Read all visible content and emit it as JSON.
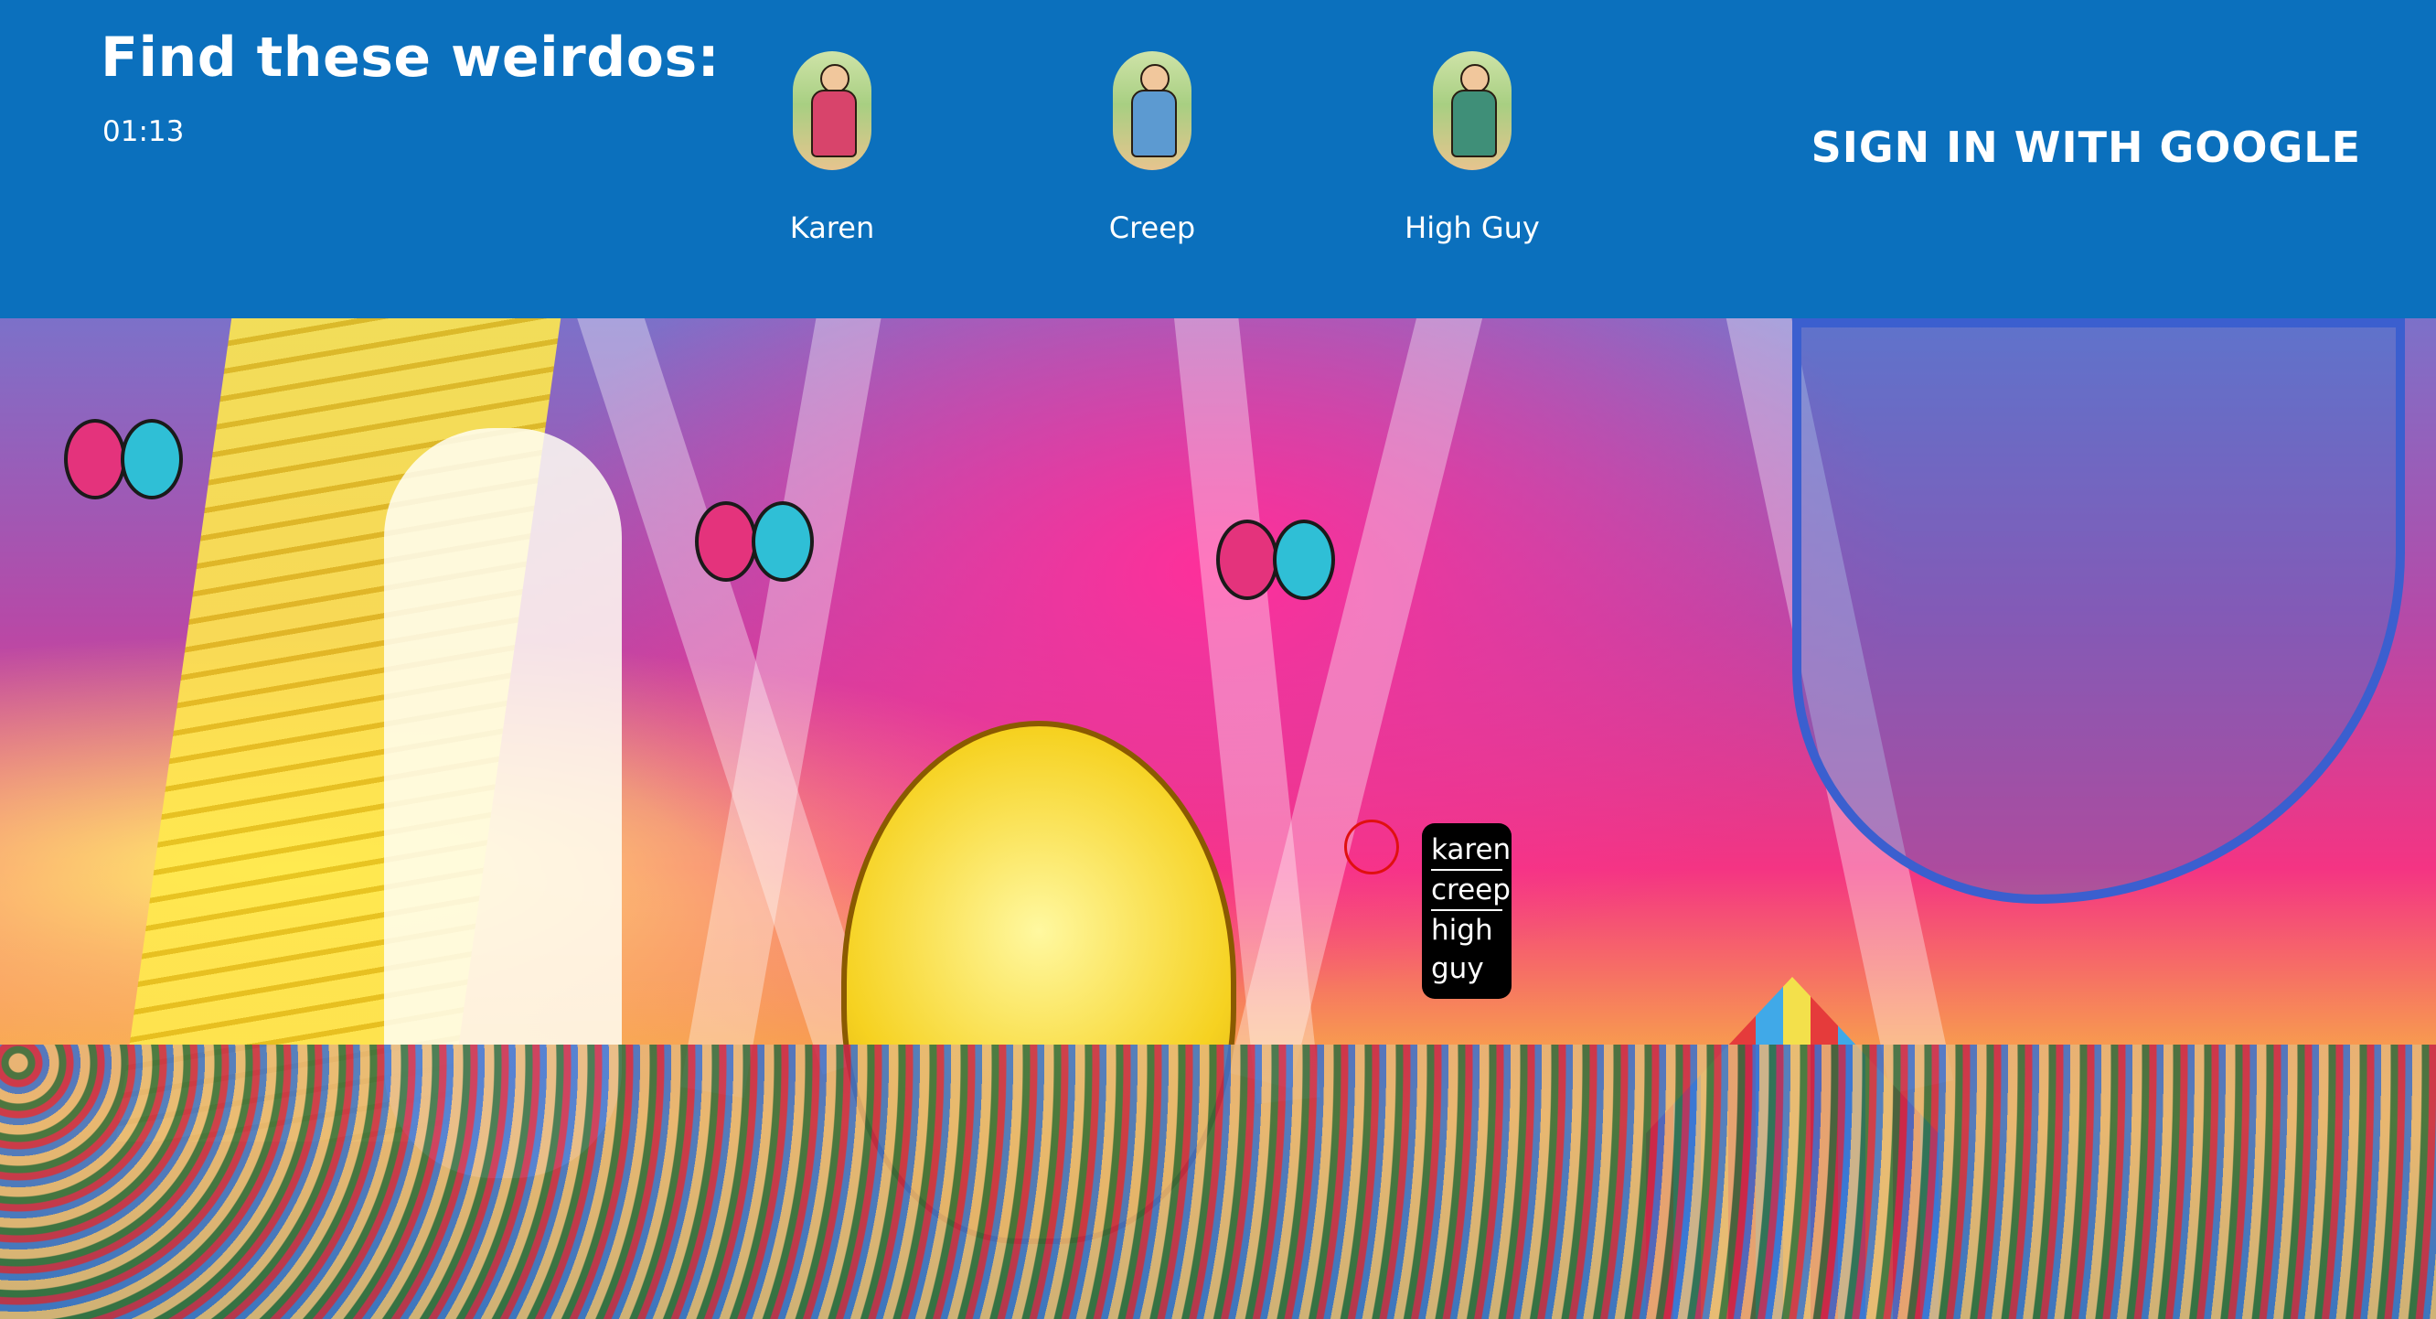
{
  "header": {
    "title": "Find these weirdos:",
    "timer": "01:13",
    "sign_in": "SIGN IN WITH GOOGLE"
  },
  "characters": [
    {
      "name": "Karen"
    },
    {
      "name": "Creep"
    },
    {
      "name": "High Guy"
    }
  ],
  "dropdown": {
    "items": [
      "karen",
      "creep",
      "high guy"
    ]
  },
  "colors": {
    "header_bg": "#0b70bd",
    "text": "#ffffff",
    "target_circle": "#e01010",
    "dropdown_bg": "#000000"
  },
  "scene": {
    "image": "festival-illustration"
  }
}
